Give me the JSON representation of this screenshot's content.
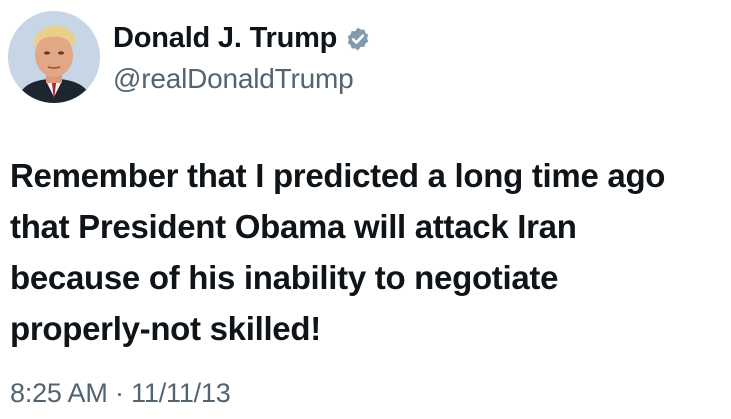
{
  "profile": {
    "display_name": "Donald J. Trump",
    "handle": "@realDonaldTrump",
    "verified": true,
    "avatar_icon": "profile-photo"
  },
  "tweet": {
    "lines": [
      "Remember that I predicted a long time ago",
      "that President Obama will attack Iran",
      "because of his inability to negotiate",
      "properly-not skilled!"
    ]
  },
  "meta": {
    "time": "8:25 AM",
    "separator": " · ",
    "date": "11/11/13"
  },
  "colors": {
    "text": "#0f1419",
    "secondary": "#536471",
    "verified_badge": "#829aab"
  }
}
